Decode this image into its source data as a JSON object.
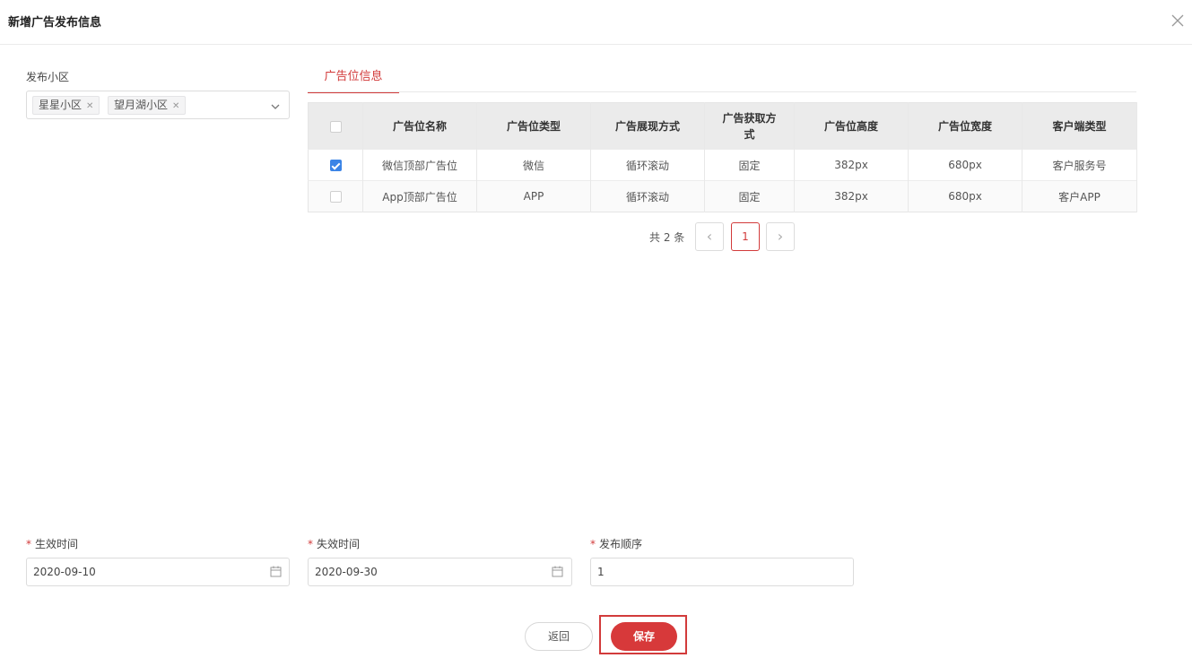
{
  "dialog": {
    "title": "新增广告发布信息"
  },
  "community": {
    "label": "发布小区",
    "tags": [
      "星星小区",
      "望月湖小区"
    ],
    "tag_remove_glyph": "✕"
  },
  "tab": {
    "label": "广告位信息"
  },
  "table": {
    "headers": [
      "广告位名称",
      "广告位类型",
      "广告展现方式",
      "广告获取方式",
      "广告位高度",
      "广告位宽度",
      "客户端类型"
    ],
    "rows": [
      {
        "checked": true,
        "cells": [
          "微信顶部广告位",
          "微信",
          "循环滚动",
          "固定",
          "382px",
          "680px",
          "客户服务号"
        ]
      },
      {
        "checked": false,
        "cells": [
          "App顶部广告位",
          "APP",
          "循环滚动",
          "固定",
          "382px",
          "680px",
          "客户APP"
        ]
      }
    ]
  },
  "pagination": {
    "total": "共 2 条",
    "prev": "‹",
    "page": "1",
    "next": "›"
  },
  "form": {
    "required_mark": "*",
    "start": {
      "label": "生效时间",
      "value": "2020-09-10"
    },
    "end": {
      "label": "失效时间",
      "value": "2020-09-30"
    },
    "order": {
      "label": "发布顺序",
      "value": "1"
    }
  },
  "actions": {
    "back": "返回",
    "save": "保存"
  },
  "colors": {
    "accent": "#d23b3b",
    "checkbox": "#3b84e6"
  },
  "icons": [
    "close-icon",
    "tag-remove-icon",
    "chevron-down-icon",
    "checkbox-icon",
    "calendar-icon",
    "chevron-left-icon",
    "chevron-right-icon"
  ]
}
